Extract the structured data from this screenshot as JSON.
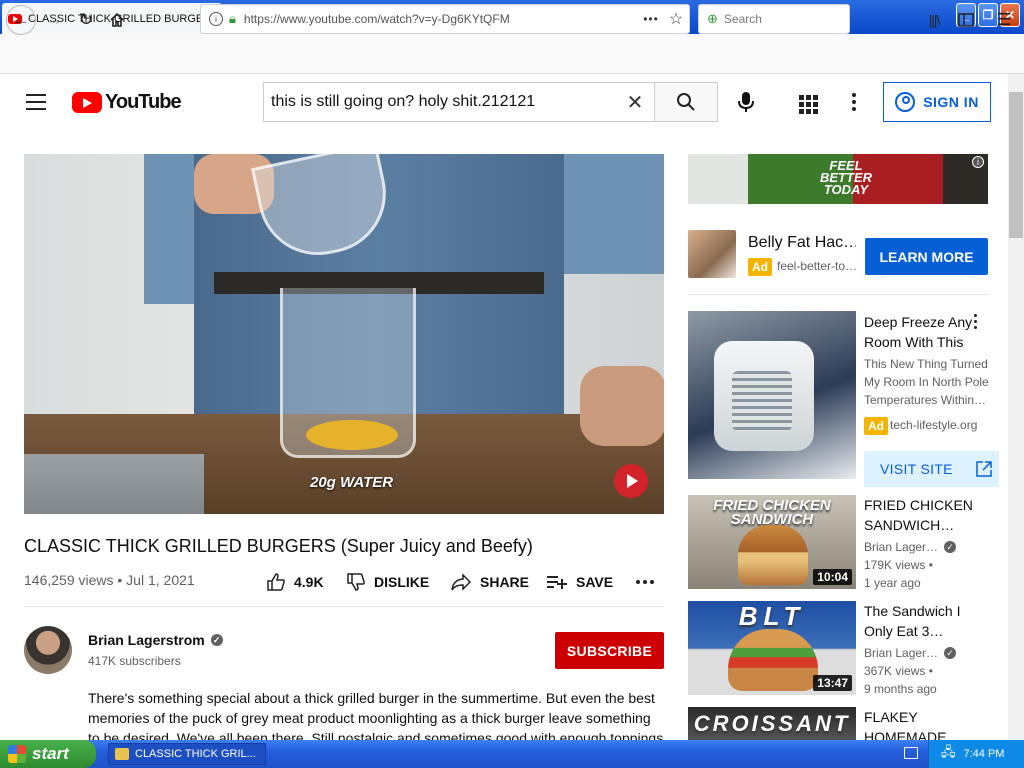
{
  "browser": {
    "tab_title": "CLASSIC THICK GRILLED BURGERS",
    "url": "https://www.youtube.com/watch?v=y-Dg6KYtQFM",
    "search_placeholder": "Search"
  },
  "yt": {
    "logo_text": "YouTube",
    "query": "this is still going on? holy shit.212121",
    "signin_label": "SIGN IN"
  },
  "video": {
    "overlay_caption": "20g WATER",
    "title": "CLASSIC THICK GRILLED BURGERS (Super Juicy and Beefy)",
    "meta": "146,259 views • Jul 1, 2021",
    "likes": "4.9K",
    "dislike_label": "DISLIKE",
    "share_label": "SHARE",
    "save_label": "SAVE"
  },
  "channel": {
    "name": "Brian Lagerstrom",
    "subscribers": "417K subscribers",
    "subscribe_label": "SUBSCRIBE"
  },
  "description": "There's something special about a thick grilled burger in the summertime. But even the best memories of the puck of grey meat product moonlighting as a thick burger leave something to be desired. We've all been there. Still nostalgic and sometimes good with enough toppings",
  "ads": {
    "banner_text": "FEEL BETTER TODAY",
    "ad2_title": "Belly Fat Hac…",
    "ad_badge": "Ad",
    "ad2_domain": "feel-better-to…",
    "learn_more": "LEARN MORE",
    "ad3_title": "Deep Freeze Any Room With This",
    "ad3_desc": "This New Thing Turned My Room In North Pole Temperatures Within…",
    "ad3_domain": "tech-lifestyle.org",
    "visit_site": "VISIT SITE"
  },
  "related": [
    {
      "thumb_text": "FRIED CHICKEN SANDWICH",
      "duration": "10:04",
      "title": "FRIED CHICKEN SANDWICH…",
      "channel": "Brian Lager…",
      "views": "179K views •",
      "age": "1 year ago"
    },
    {
      "thumb_text": "BLT",
      "duration": "13:47",
      "title": "The Sandwich I Only Eat 3…",
      "channel": "Brian Lager…",
      "views": "367K views •",
      "age": "9 months ago"
    },
    {
      "thumb_text": "CROISSANT",
      "title": "FLAKEY HOMEMADE"
    }
  ],
  "taskbar": {
    "start_label": "start",
    "task_item": "CLASSIC THICK GRIL...",
    "clock": "7:44 PM"
  }
}
